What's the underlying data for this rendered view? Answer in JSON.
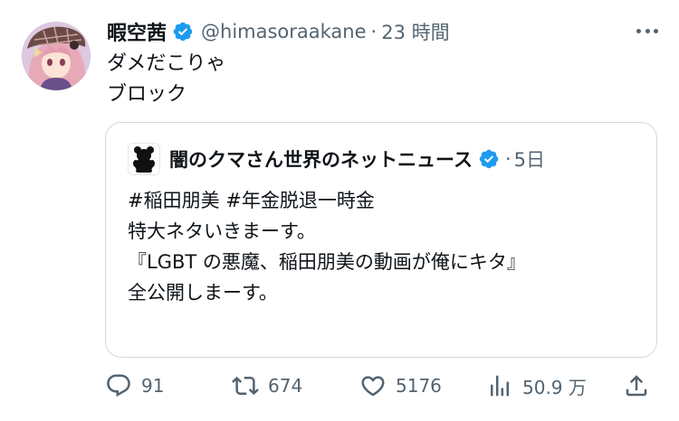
{
  "tweet": {
    "display_name": "暇空茜",
    "handle": "@himasoraakane",
    "separator": "·",
    "time": "23 時間",
    "text_lines": [
      "ダメだこりゃ",
      "ブロック"
    ]
  },
  "quoted": {
    "display_name": "闇のクマさん世界のネットニュース",
    "separator": "·",
    "time": "5日",
    "text_lines": [
      "#稲田朋美 #年金脱退一時金",
      "特大ネタいきまーす。",
      "『LGBT の悪魔、稲田朋美の動画が俺にキタ』",
      "全公開しまーす。"
    ]
  },
  "actions": {
    "replies": "91",
    "retweets": "674",
    "likes": "5176",
    "views": "50.9 万"
  },
  "colors": {
    "verified_blue": "#1d9bf0",
    "secondary_text": "#536471",
    "border": "#cfd9de"
  },
  "icons": [
    "avatar",
    "verified-badge-icon",
    "more-icon",
    "reply-icon",
    "retweet-icon",
    "like-icon",
    "views-icon",
    "share-icon",
    "bear-icon"
  ]
}
